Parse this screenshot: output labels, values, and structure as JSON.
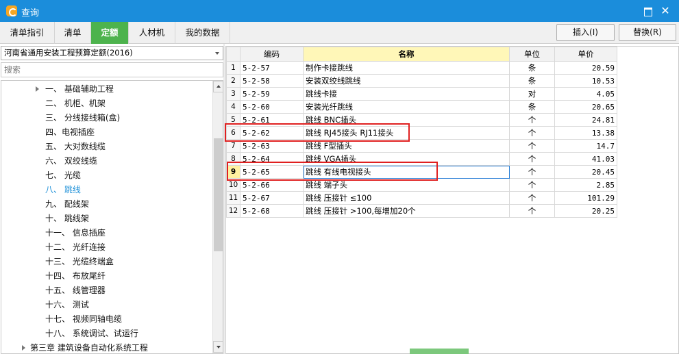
{
  "window": {
    "title": "查询"
  },
  "tabs": [
    {
      "label": "清单指引",
      "active": false
    },
    {
      "label": "清单",
      "active": false
    },
    {
      "label": "定额",
      "active": true
    },
    {
      "label": "人材机",
      "active": false
    },
    {
      "label": "我的数据",
      "active": false
    }
  ],
  "toolbar": {
    "insert_label": "插入(I)",
    "replace_label": "替换(R)"
  },
  "library": {
    "selected": "河南省通用安装工程预算定额(2016)"
  },
  "search": {
    "placeholder": "搜索"
  },
  "tree": {
    "items": [
      {
        "label": "一、 基础辅助工程",
        "expandable": true
      },
      {
        "label": "二、 机柜、机架"
      },
      {
        "label": "三、 分线接线箱(盒)"
      },
      {
        "label": "四、电视插座"
      },
      {
        "label": "五、 大对数线缆"
      },
      {
        "label": "六、 双绞线缆"
      },
      {
        "label": "七、 光缆"
      },
      {
        "label": "八、 跳线",
        "selected": true
      },
      {
        "label": "九、 配线架"
      },
      {
        "label": "十、 跳线架"
      },
      {
        "label": "十一、 信息插座"
      },
      {
        "label": "十二、 光纤连接"
      },
      {
        "label": "十三、 光缆终端盒"
      },
      {
        "label": "十四、 布放尾纤"
      },
      {
        "label": "十五、 线管理器"
      },
      {
        "label": "十六、 测试"
      },
      {
        "label": "十七、 视频同轴电缆"
      },
      {
        "label": "十八、 系统调试、试运行"
      },
      {
        "label": "第三章 建筑设备自动化系统工程",
        "expandable": true
      }
    ]
  },
  "grid": {
    "columns": [
      "编码",
      "名称",
      "单位",
      "单价"
    ],
    "rows": [
      {
        "no": "1",
        "code": "5-2-57",
        "name": "制作卡接跳线",
        "unit": "条",
        "price": "20.59"
      },
      {
        "no": "2",
        "code": "5-2-58",
        "name": "安装双绞线跳线",
        "unit": "条",
        "price": "10.53"
      },
      {
        "no": "3",
        "code": "5-2-59",
        "name": "跳线卡接",
        "unit": "对",
        "price": "4.05"
      },
      {
        "no": "4",
        "code": "5-2-60",
        "name": "安装光纤跳线",
        "unit": "条",
        "price": "20.65"
      },
      {
        "no": "5",
        "code": "5-2-61",
        "name": "跳线 BNC插头",
        "unit": "个",
        "price": "24.81"
      },
      {
        "no": "6",
        "code": "5-2-62",
        "name": "跳线 RJ45接头 RJ11接头",
        "unit": "个",
        "price": "13.38"
      },
      {
        "no": "7",
        "code": "5-2-63",
        "name": "跳线 F型插头",
        "unit": "个",
        "price": "14.7"
      },
      {
        "no": "8",
        "code": "5-2-64",
        "name": "跳线 VGA插头",
        "unit": "个",
        "price": "41.03"
      },
      {
        "no": "9",
        "code": "5-2-65",
        "name": "跳线 有线电视接头",
        "unit": "个",
        "price": "20.45",
        "current": true
      },
      {
        "no": "10",
        "code": "5-2-66",
        "name": "跳线 端子头",
        "unit": "个",
        "price": "2.85"
      },
      {
        "no": "11",
        "code": "5-2-67",
        "name": "跳线 压接针 ≤100",
        "unit": "个",
        "price": "101.29"
      },
      {
        "no": "12",
        "code": "5-2-68",
        "name": "跳线 压接针 >100,每增加20个",
        "unit": "个",
        "price": "20.25"
      }
    ]
  },
  "colors": {
    "titlebar": "#1b8ddb",
    "active_tab": "#4db34d",
    "highlight": "#e02020",
    "selected_tree": "#1e90d8"
  }
}
